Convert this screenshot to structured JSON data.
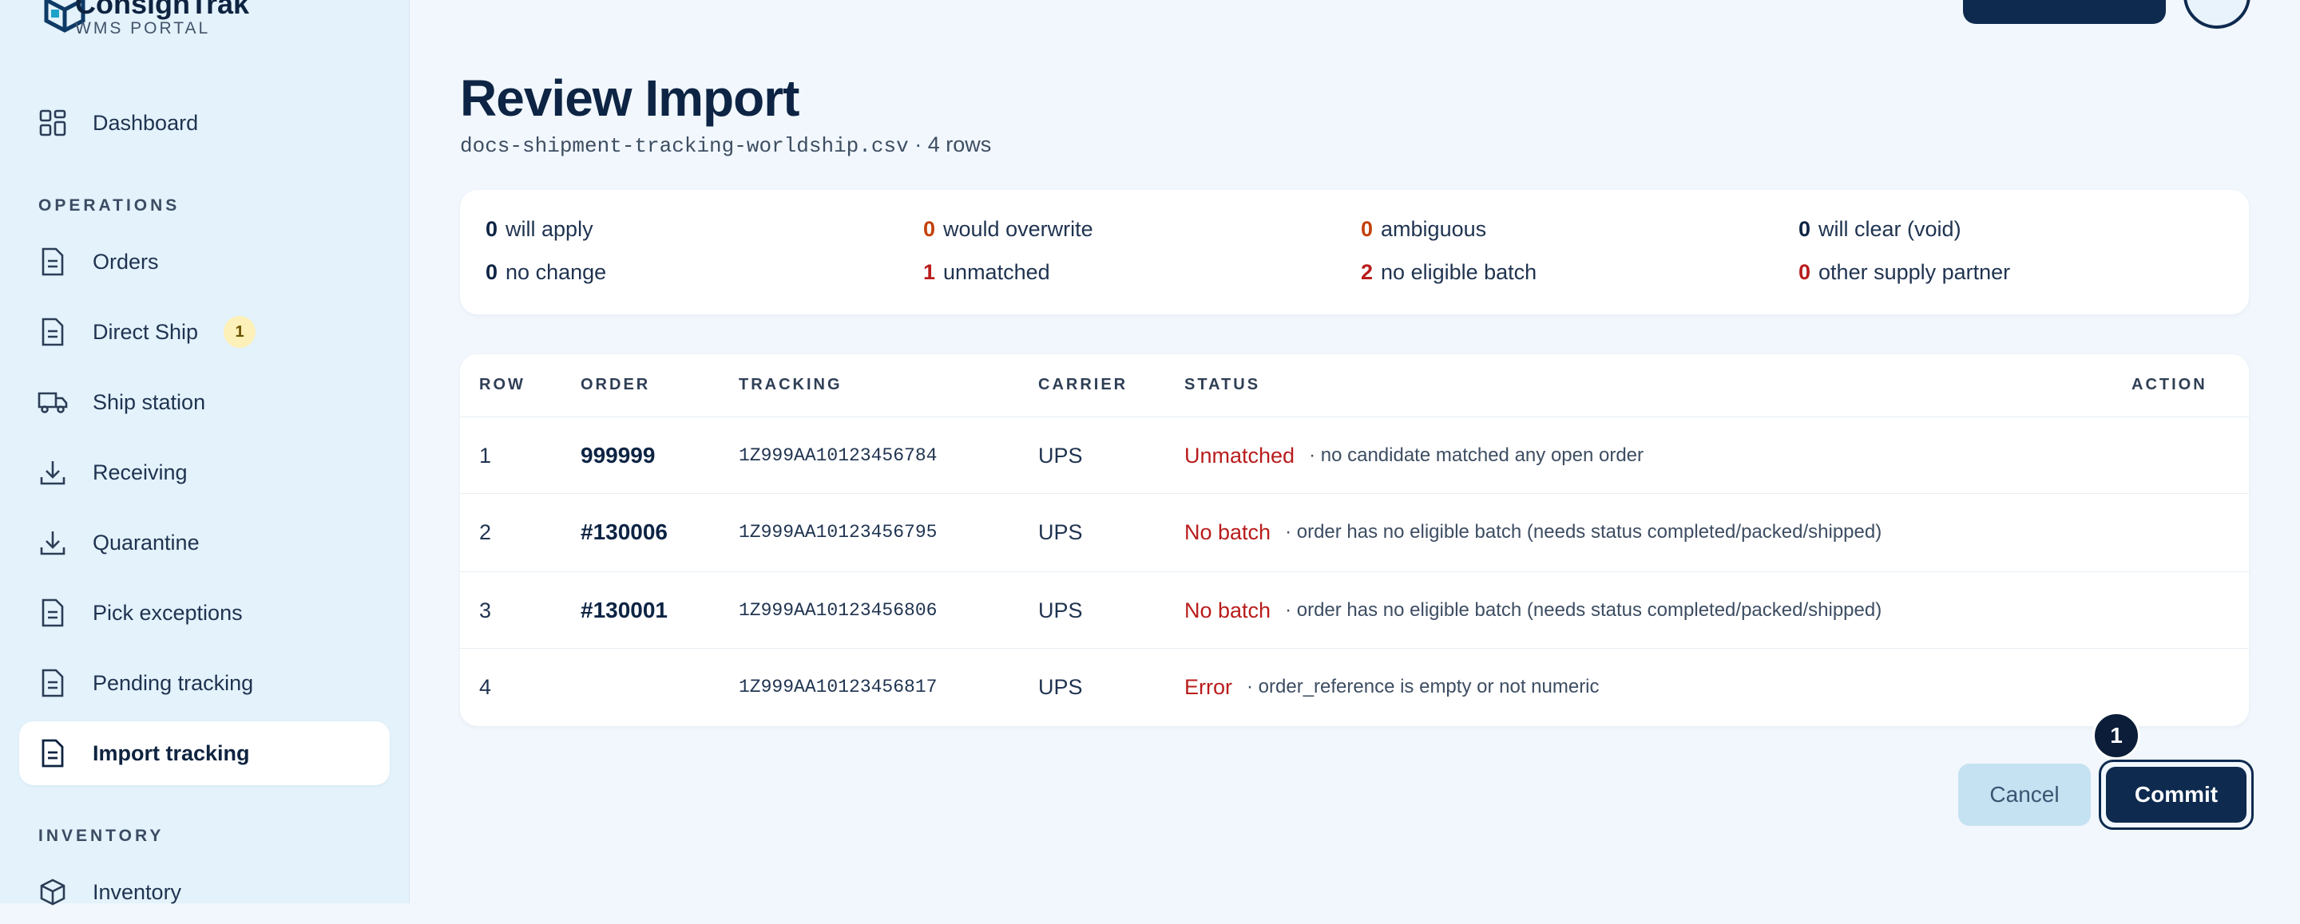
{
  "app": {
    "brand_name": "ConsignTrak",
    "brand_sub": "WMS PORTAL"
  },
  "sidebar": {
    "dashboard": "Dashboard",
    "operations_label": "OPERATIONS",
    "items": [
      {
        "label": "Orders",
        "icon": "document-icon"
      },
      {
        "label": "Direct Ship",
        "icon": "document-icon",
        "badge": "1"
      },
      {
        "label": "Ship station",
        "icon": "truck-icon"
      },
      {
        "label": "Receiving",
        "icon": "download-icon"
      },
      {
        "label": "Quarantine",
        "icon": "download-icon"
      },
      {
        "label": "Pick exceptions",
        "icon": "document-icon"
      },
      {
        "label": "Pending tracking",
        "icon": "document-icon"
      },
      {
        "label": "Import tracking",
        "icon": "document-icon",
        "active": true
      }
    ],
    "inventory_label": "INVENTORY",
    "inventory": "Inventory"
  },
  "page": {
    "title": "Review Import",
    "filename": "docs-shipment-tracking-worldship.csv",
    "row_count": "· 4 rows"
  },
  "summary": [
    {
      "count": "0",
      "label": "will apply",
      "color": "#0d2444"
    },
    {
      "count": "0",
      "label": "would overwrite",
      "color": "#c2410c"
    },
    {
      "count": "0",
      "label": "ambiguous",
      "color": "#c2410c"
    },
    {
      "count": "0",
      "label": "will clear (void)",
      "color": "#0d2444"
    },
    {
      "count": "0",
      "label": "no change",
      "color": "#0d2444"
    },
    {
      "count": "1",
      "label": "unmatched",
      "color": "#b91c1c"
    },
    {
      "count": "2",
      "label": "no eligible batch",
      "color": "#b91c1c"
    },
    {
      "count": "0",
      "label": "other supply partner",
      "color": "#b91c1c"
    }
  ],
  "table": {
    "headers": [
      "ROW",
      "ORDER",
      "TRACKING",
      "CARRIER",
      "STATUS",
      "ACTION"
    ],
    "rows": [
      {
        "row": "1",
        "order": "999999",
        "tracking": "1Z999AA10123456784",
        "carrier": "UPS",
        "status": "Unmatched",
        "note": "· no candidate matched any open order"
      },
      {
        "row": "2",
        "order": "#130006",
        "tracking": "1Z999AA10123456795",
        "carrier": "UPS",
        "status": "No batch",
        "note": "· order has no eligible batch (needs status completed/packed/shipped)"
      },
      {
        "row": "3",
        "order": "#130001",
        "tracking": "1Z999AA10123456806",
        "carrier": "UPS",
        "status": "No batch",
        "note": "· order has no eligible batch (needs status completed/packed/shipped)"
      },
      {
        "row": "4",
        "order": "",
        "tracking": "1Z999AA10123456817",
        "carrier": "UPS",
        "status": "Error",
        "note": "· order_reference is empty or not numeric"
      }
    ]
  },
  "actions": {
    "cancel": "Cancel",
    "commit": "Commit",
    "step_marker": "1"
  },
  "colors": {
    "primary": "#0e2a4f",
    "danger": "#b91c1c",
    "warning": "#c2410c",
    "sidebar_bg": "#e3f2fb",
    "badge_bg": "#fdf0b8"
  }
}
